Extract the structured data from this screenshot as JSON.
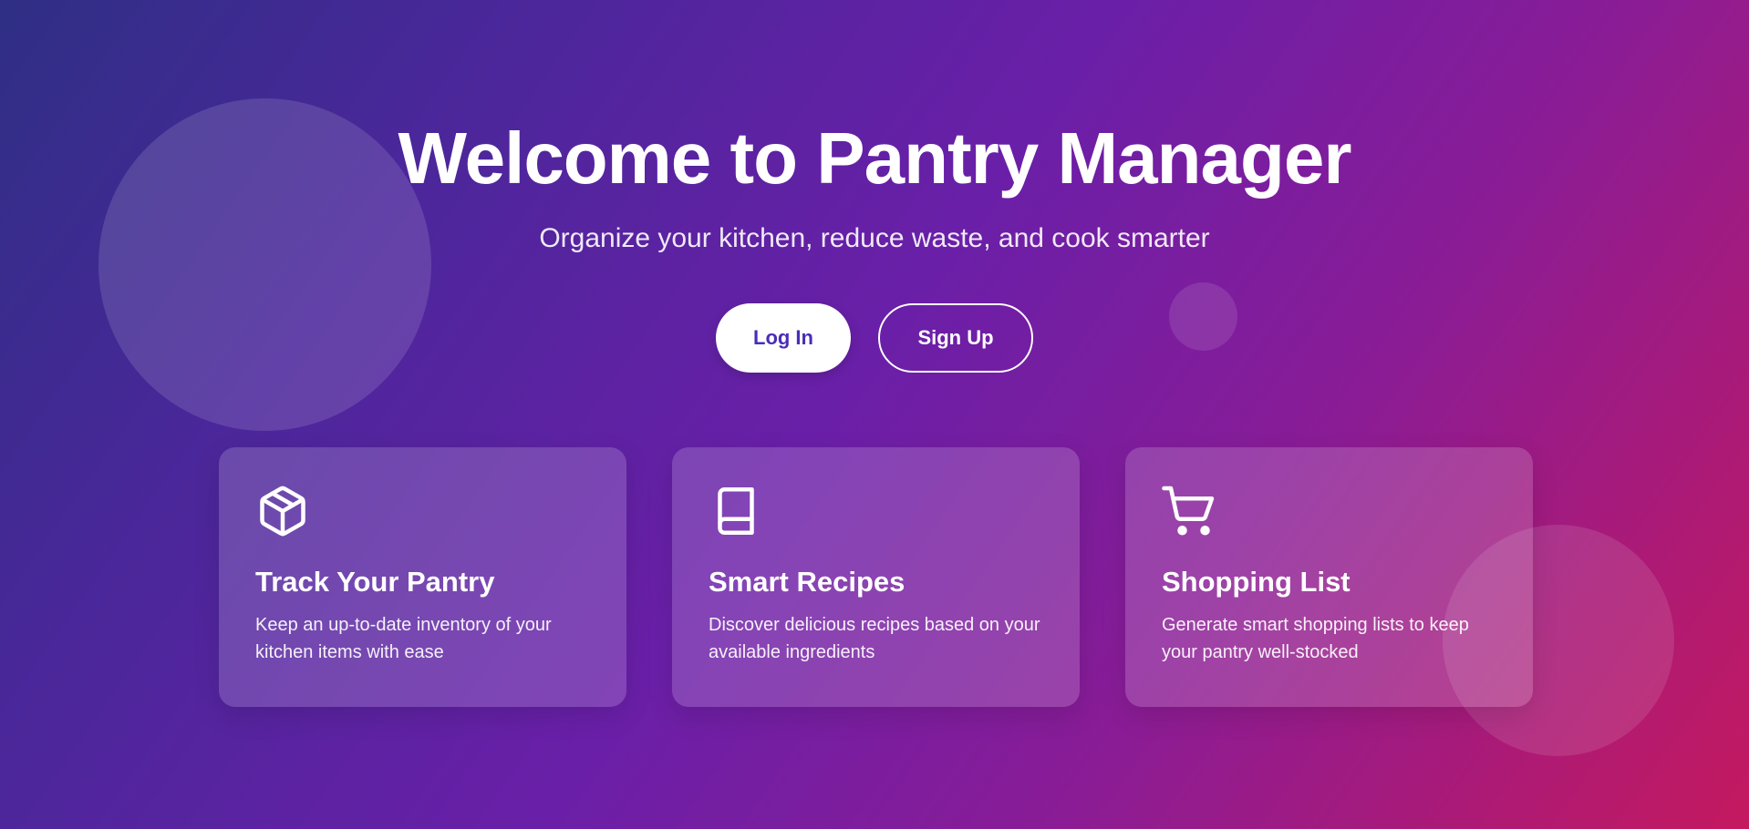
{
  "hero": {
    "title": "Welcome to Pantry Manager",
    "subtitle": "Organize your kitchen, reduce waste, and cook smarter",
    "login_label": "Log In",
    "signup_label": "Sign Up"
  },
  "features": [
    {
      "icon": "box-icon",
      "title": "Track Your Pantry",
      "description": "Keep an up-to-date inventory of your kitchen items with ease"
    },
    {
      "icon": "book-icon",
      "title": "Smart Recipes",
      "description": "Discover delicious recipes based on your available ingredients"
    },
    {
      "icon": "shopping-cart-icon",
      "title": "Shopping List",
      "description": "Generate smart shopping lists to keep your pantry well-stocked"
    }
  ],
  "colors": {
    "gradient_start": "#2f2f85",
    "gradient_mid": "#6a1fa8",
    "gradient_end": "#c4195f",
    "login_text": "#4b2cb8"
  }
}
